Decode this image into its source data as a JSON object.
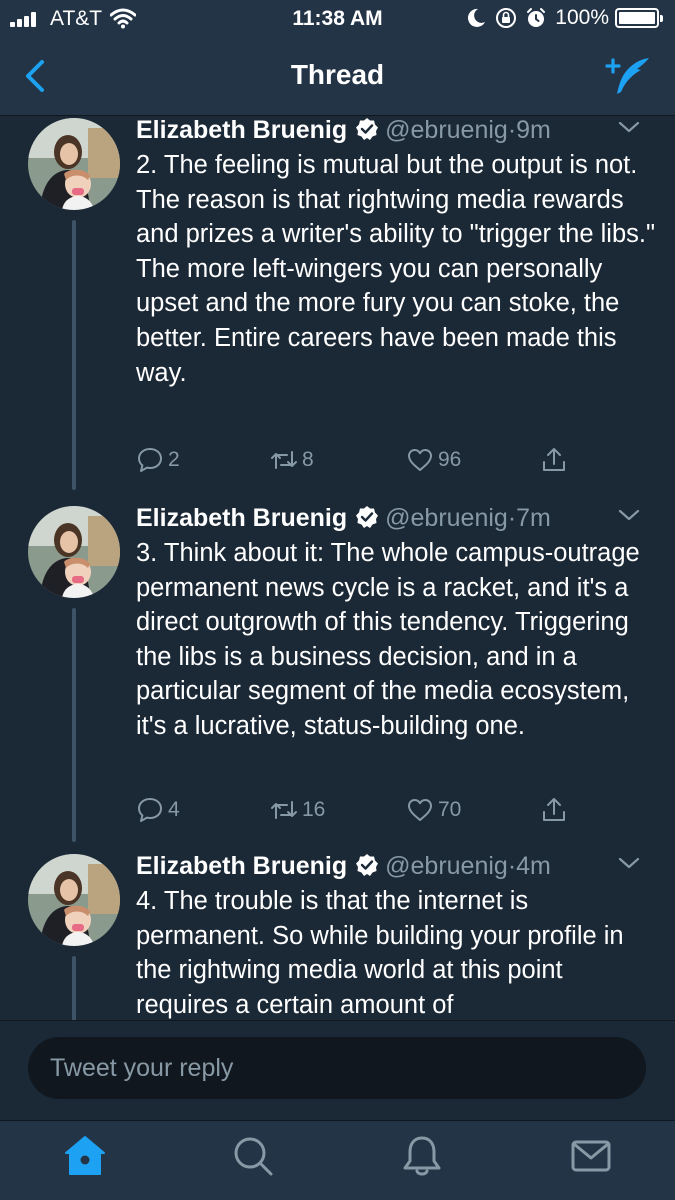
{
  "status_bar": {
    "carrier": "AT&T",
    "time": "11:38 AM",
    "battery_percent": "100%",
    "battery_level": 1.0,
    "icons": [
      "signal-icon",
      "wifi-icon",
      "moon-icon",
      "rotation-lock-icon",
      "alarm-icon",
      "battery-icon"
    ]
  },
  "nav": {
    "title": "Thread",
    "back_icon": "chevron-left-icon",
    "compose_icon": "compose-tweet-icon"
  },
  "tweets": [
    {
      "author": "Elizabeth Bruenig",
      "handle": "@ebruenig",
      "separator": "·",
      "time": "9m",
      "text": "2. The feeling is mutual but the output is not. The reason is that rightwing media rewards and prizes a writer's ability to \"trigger the libs.\" The more left-wingers you can personally upset and the more fury you can stoke, the better. Entire careers have been made this way.",
      "replies": "2",
      "retweets": "8",
      "likes": "96"
    },
    {
      "author": "Elizabeth Bruenig",
      "handle": "@ebruenig",
      "separator": "·",
      "time": "7m",
      "text": "3. Think about it: The whole campus-outrage permanent news cycle is a racket, and it's a direct outgrowth of this tendency. Triggering the libs is a business decision, and in a particular segment of the media ecosystem, it's a lucrative, status-building one.",
      "replies": "4",
      "retweets": "16",
      "likes": "70"
    },
    {
      "author": "Elizabeth Bruenig",
      "handle": "@ebruenig",
      "separator": "·",
      "time": "4m",
      "text": "4. The trouble is that the internet is permanent. So while building your profile in the rightwing media world at this point requires a certain amount of"
    }
  ],
  "reply": {
    "placeholder": "Tweet your reply"
  },
  "tab_bar": {
    "items": [
      "home-icon",
      "search-icon",
      "notifications-icon",
      "messages-icon"
    ],
    "active": "home-icon"
  },
  "colors": {
    "background": "#1b2836",
    "bar": "#243447",
    "accent": "#1da1f2",
    "muted": "#8899a6",
    "text": "#ffffff"
  }
}
